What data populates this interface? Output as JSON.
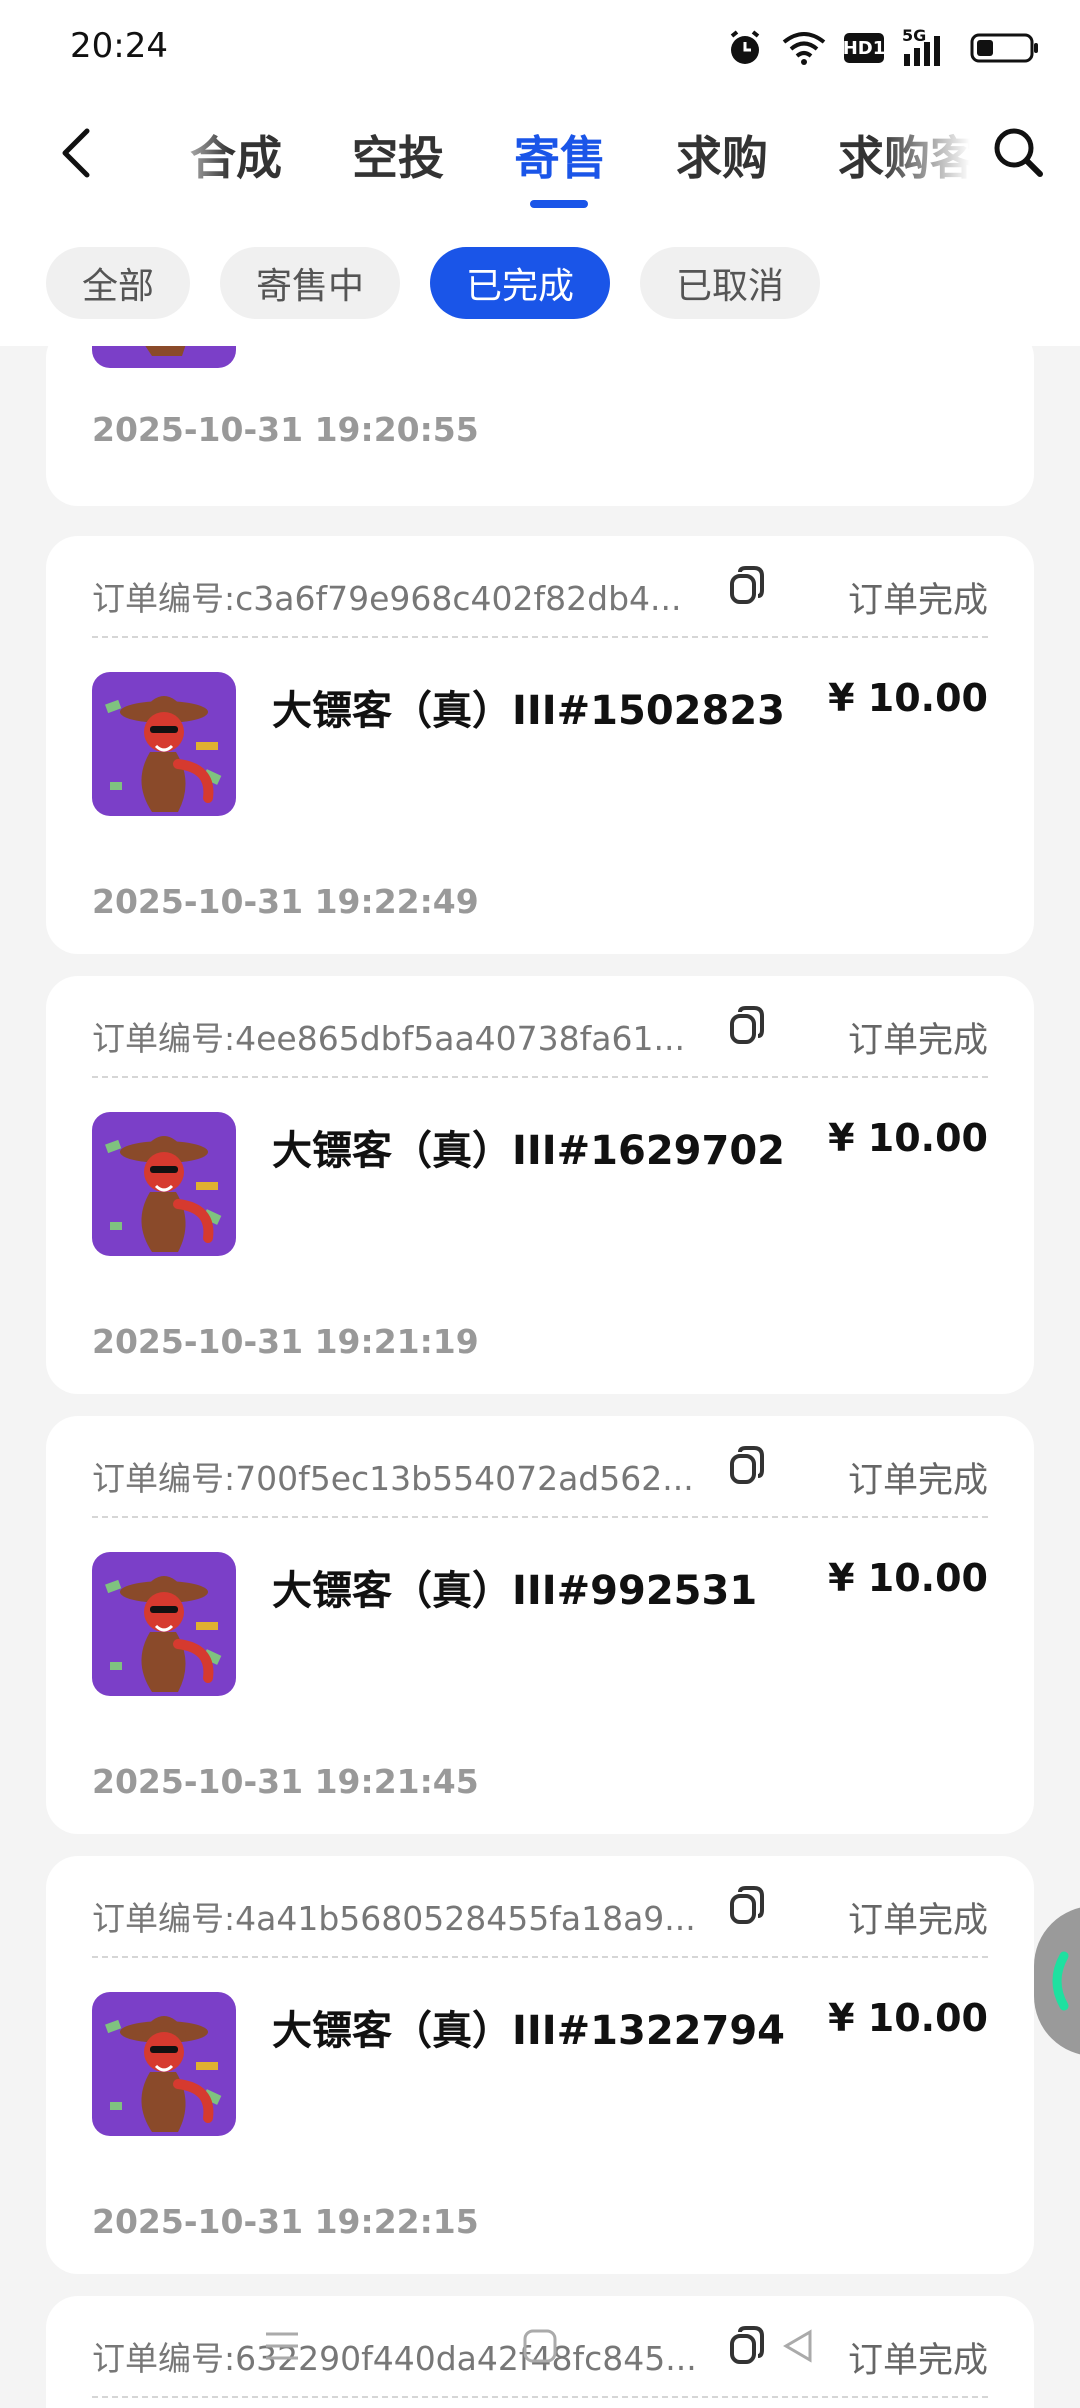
{
  "status_bar": {
    "time": "20:24",
    "icons": [
      "alarm-icon",
      "wifi-icon",
      "hd-icon",
      "signal-5g-icon",
      "battery-icon"
    ],
    "hd_label": "HD1",
    "signal_label": "5G"
  },
  "nav": {
    "tabs": [
      {
        "label": "合成",
        "active": false
      },
      {
        "label": "空投",
        "active": false
      },
      {
        "label": "寄售",
        "active": true
      },
      {
        "label": "求购",
        "active": false
      },
      {
        "label": "求购客",
        "active": false
      }
    ],
    "accent_color": "#1a55e8"
  },
  "filters": {
    "items": [
      {
        "label": "全部",
        "active": false
      },
      {
        "label": "寄售中",
        "active": false
      },
      {
        "label": "已完成",
        "active": true
      },
      {
        "label": "已取消",
        "active": false
      }
    ]
  },
  "top_partial_card": {
    "date": "2025-10-31 19:20:55"
  },
  "orders": [
    {
      "order_label": "订单编号:",
      "order_id": "c3a6f79e968c402f82db4...",
      "status": "订单完成",
      "item_name": "大镖客（真）III#1502823",
      "price": "¥ 10.00",
      "date": "2025-10-31 19:22:49"
    },
    {
      "order_label": "订单编号:",
      "order_id": "4ee865dbf5aa40738fa61...",
      "status": "订单完成",
      "item_name": "大镖客（真）III#1629702",
      "price": "¥ 10.00",
      "date": "2025-10-31 19:21:19"
    },
    {
      "order_label": "订单编号:",
      "order_id": "700f5ec13b554072ad562...",
      "status": "订单完成",
      "item_name": "大镖客（真）III#992531",
      "price": "¥ 10.00",
      "date": "2025-10-31 19:21:45"
    },
    {
      "order_label": "订单编号:",
      "order_id": "4a41b5680528455fa18a9...",
      "status": "订单完成",
      "item_name": "大镖客（真）III#1322794",
      "price": "¥ 10.00",
      "date": "2025-10-31 19:22:15"
    },
    {
      "order_label": "订单编号:",
      "order_id": "632290f440da42f48fc845...",
      "status": "订单完成",
      "item_name": "",
      "price": "",
      "date": ""
    }
  ]
}
